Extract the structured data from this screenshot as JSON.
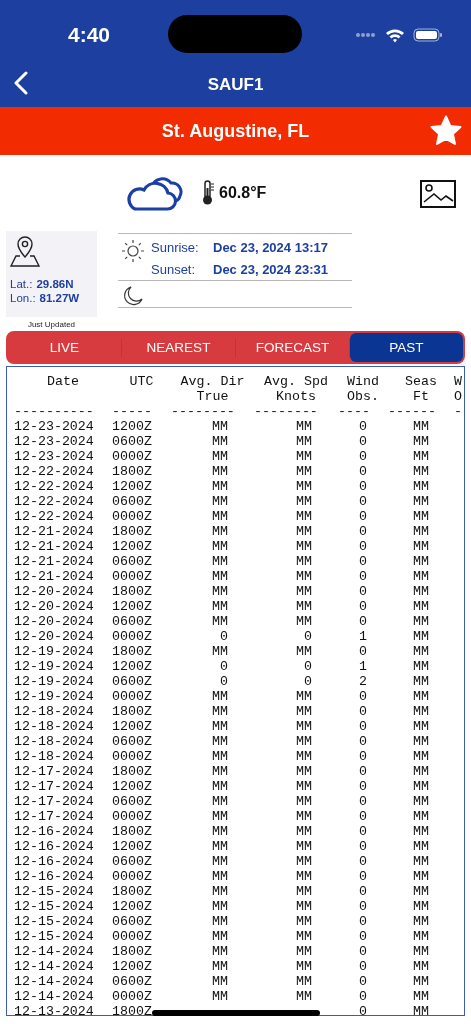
{
  "status_bar": {
    "time": "4:40"
  },
  "nav": {
    "title": "SAUF1"
  },
  "station": {
    "name": "St. Augustine, FL",
    "favorite": true
  },
  "current": {
    "temperature": "60.8°F"
  },
  "location": {
    "lat_label": "Lat.:",
    "lat": "29.86N",
    "lon_label": "Lon.:",
    "lon": "81.27W",
    "updated": "Just Updated"
  },
  "sun": {
    "sunrise_label": "Sunrise:",
    "sunrise": "Dec 23, 2024 13:17",
    "sunset_label": "Sunset:",
    "sunset": "Dec 23, 2024 23:31"
  },
  "tabs": [
    {
      "label": "LIVE",
      "selected": false
    },
    {
      "label": "NEAREST",
      "selected": false
    },
    {
      "label": "FORECAST",
      "selected": false
    },
    {
      "label": "PAST",
      "selected": true
    }
  ],
  "table": {
    "columns": [
      {
        "lines": [
          "Date"
        ],
        "dashes": "----------"
      },
      {
        "lines": [
          "UTC"
        ],
        "dashes": "-----"
      },
      {
        "lines": [
          "Avg. Dir",
          "True"
        ],
        "dashes": "--------"
      },
      {
        "lines": [
          "Avg. Spd",
          "Knots"
        ],
        "dashes": "--------"
      },
      {
        "lines": [
          "Wind",
          "Obs."
        ],
        "dashes": "----"
      },
      {
        "lines": [
          "Seas",
          "Ft"
        ],
        "dashes": "------"
      },
      {
        "lines": [
          "W",
          "O"
        ],
        "dashes": "-"
      }
    ],
    "rows": [
      [
        "12-23-2024",
        "1200Z",
        "MM",
        "MM",
        "0",
        "MM"
      ],
      [
        "12-23-2024",
        "0600Z",
        "MM",
        "MM",
        "0",
        "MM"
      ],
      [
        "12-23-2024",
        "0000Z",
        "MM",
        "MM",
        "0",
        "MM"
      ],
      [
        "12-22-2024",
        "1800Z",
        "MM",
        "MM",
        "0",
        "MM"
      ],
      [
        "12-22-2024",
        "1200Z",
        "MM",
        "MM",
        "0",
        "MM"
      ],
      [
        "12-22-2024",
        "0600Z",
        "MM",
        "MM",
        "0",
        "MM"
      ],
      [
        "12-22-2024",
        "0000Z",
        "MM",
        "MM",
        "0",
        "MM"
      ],
      [
        "12-21-2024",
        "1800Z",
        "MM",
        "MM",
        "0",
        "MM"
      ],
      [
        "12-21-2024",
        "1200Z",
        "MM",
        "MM",
        "0",
        "MM"
      ],
      [
        "12-21-2024",
        "0600Z",
        "MM",
        "MM",
        "0",
        "MM"
      ],
      [
        "12-21-2024",
        "0000Z",
        "MM",
        "MM",
        "0",
        "MM"
      ],
      [
        "12-20-2024",
        "1800Z",
        "MM",
        "MM",
        "0",
        "MM"
      ],
      [
        "12-20-2024",
        "1200Z",
        "MM",
        "MM",
        "0",
        "MM"
      ],
      [
        "12-20-2024",
        "0600Z",
        "MM",
        "MM",
        "0",
        "MM"
      ],
      [
        "12-20-2024",
        "0000Z",
        "0",
        "0",
        "1",
        "MM"
      ],
      [
        "12-19-2024",
        "1800Z",
        "MM",
        "MM",
        "0",
        "MM"
      ],
      [
        "12-19-2024",
        "1200Z",
        "0",
        "0",
        "1",
        "MM"
      ],
      [
        "12-19-2024",
        "0600Z",
        "0",
        "0",
        "2",
        "MM"
      ],
      [
        "12-19-2024",
        "0000Z",
        "MM",
        "MM",
        "0",
        "MM"
      ],
      [
        "12-18-2024",
        "1800Z",
        "MM",
        "MM",
        "0",
        "MM"
      ],
      [
        "12-18-2024",
        "1200Z",
        "MM",
        "MM",
        "0",
        "MM"
      ],
      [
        "12-18-2024",
        "0600Z",
        "MM",
        "MM",
        "0",
        "MM"
      ],
      [
        "12-18-2024",
        "0000Z",
        "MM",
        "MM",
        "0",
        "MM"
      ],
      [
        "12-17-2024",
        "1800Z",
        "MM",
        "MM",
        "0",
        "MM"
      ],
      [
        "12-17-2024",
        "1200Z",
        "MM",
        "MM",
        "0",
        "MM"
      ],
      [
        "12-17-2024",
        "0600Z",
        "MM",
        "MM",
        "0",
        "MM"
      ],
      [
        "12-17-2024",
        "0000Z",
        "MM",
        "MM",
        "0",
        "MM"
      ],
      [
        "12-16-2024",
        "1800Z",
        "MM",
        "MM",
        "0",
        "MM"
      ],
      [
        "12-16-2024",
        "1200Z",
        "MM",
        "MM",
        "0",
        "MM"
      ],
      [
        "12-16-2024",
        "0600Z",
        "MM",
        "MM",
        "0",
        "MM"
      ],
      [
        "12-16-2024",
        "0000Z",
        "MM",
        "MM",
        "0",
        "MM"
      ],
      [
        "12-15-2024",
        "1800Z",
        "MM",
        "MM",
        "0",
        "MM"
      ],
      [
        "12-15-2024",
        "1200Z",
        "MM",
        "MM",
        "0",
        "MM"
      ],
      [
        "12-15-2024",
        "0600Z",
        "MM",
        "MM",
        "0",
        "MM"
      ],
      [
        "12-15-2024",
        "0000Z",
        "MM",
        "MM",
        "0",
        "MM"
      ],
      [
        "12-14-2024",
        "1800Z",
        "MM",
        "MM",
        "0",
        "MM"
      ],
      [
        "12-14-2024",
        "1200Z",
        "MM",
        "MM",
        "0",
        "MM"
      ],
      [
        "12-14-2024",
        "0600Z",
        "MM",
        "MM",
        "0",
        "MM"
      ],
      [
        "12-14-2024",
        "0000Z",
        "MM",
        "MM",
        "0",
        "MM"
      ],
      [
        "12-13-2024",
        "1800Z",
        null,
        null,
        "0",
        "MM"
      ]
    ]
  }
}
